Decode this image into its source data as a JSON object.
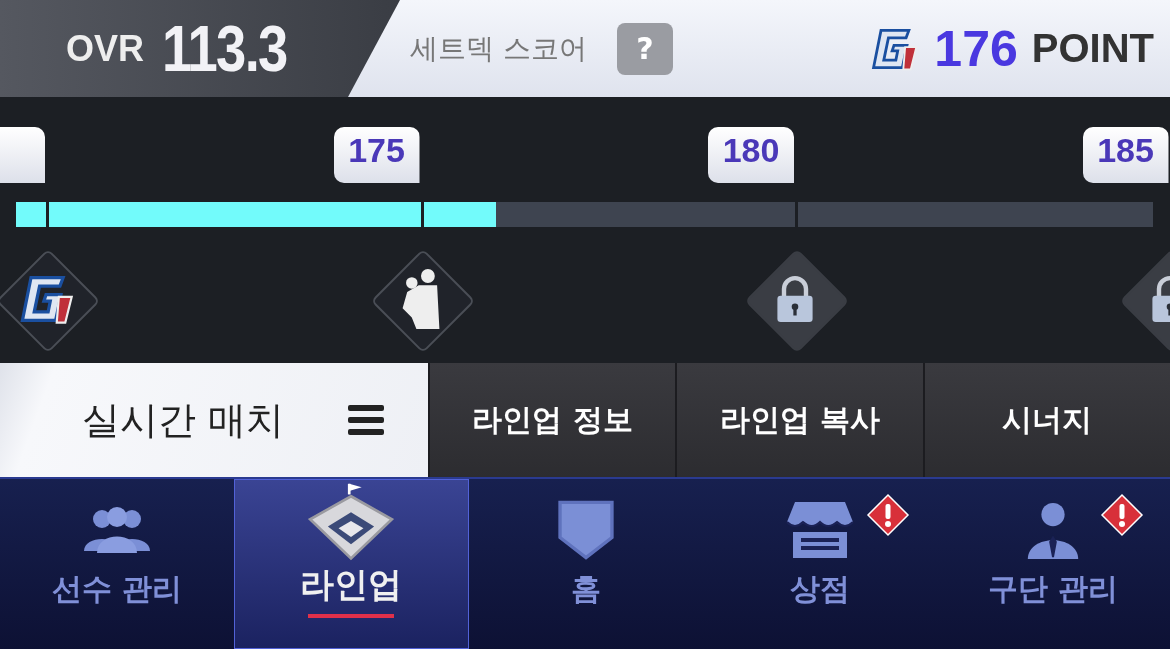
{
  "header": {
    "ovr_label": "OVR",
    "ovr_value": "113.3",
    "score_label": "세트덱 스코어",
    "help": "?",
    "points": "176",
    "points_unit": "POINT"
  },
  "track": {
    "level": 0.422,
    "milestones": [
      {
        "kind": "logo"
      },
      {
        "label": "175",
        "kind": "player"
      },
      {
        "label": "180",
        "kind": "locked"
      },
      {
        "label": "185",
        "kind": "locked"
      }
    ]
  },
  "menu": {
    "mode": "실시간 매치",
    "buttons": [
      "라인업 정보",
      "라인업 복사",
      "시너지"
    ]
  },
  "nav": [
    {
      "label": "선수 관리",
      "kind": "people",
      "selected": false,
      "alert": false
    },
    {
      "label": "라인업",
      "kind": "stadium",
      "selected": true,
      "alert": false
    },
    {
      "label": "홈",
      "kind": "home",
      "selected": false,
      "alert": false
    },
    {
      "label": "상점",
      "kind": "shop",
      "selected": false,
      "alert": true
    },
    {
      "label": "구단 관리",
      "kind": "manager",
      "selected": false,
      "alert": true
    }
  ]
}
